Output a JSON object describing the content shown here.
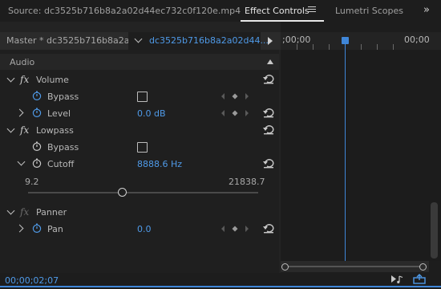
{
  "tabs": {
    "source": "Source: dc3525b716b8a2a02d44ec732c0f120e.mp4",
    "effect_controls": "Effect Controls",
    "lumetri": "Lumetri Scopes",
    "overflow": "»"
  },
  "clip_bar": {
    "master": "Master * dc3525b716b8a2a...",
    "clip": "dc3525b716b8a2a02d44..."
  },
  "timeline": {
    "time_left": ";00;00",
    "time_right": "00;00"
  },
  "panel": {
    "section": "Audio",
    "volume": {
      "name": "Volume",
      "bypass_label": "Bypass",
      "level_label": "Level",
      "level_value": "0.0 dB"
    },
    "lowpass": {
      "name": "Lowpass",
      "bypass_label": "Bypass",
      "cutoff_label": "Cutoff",
      "cutoff_value": "8888.6 Hz",
      "slider_min": "9.2",
      "slider_max": "21838.7",
      "slider_fraction": 0.407
    },
    "panner": {
      "name": "Panner",
      "pan_label": "Pan",
      "pan_value": "0.0"
    }
  },
  "status": {
    "timecode": "00;00;02;07"
  },
  "colors": {
    "accent": "#4f9ae8",
    "playhead": "#3f86d8"
  }
}
